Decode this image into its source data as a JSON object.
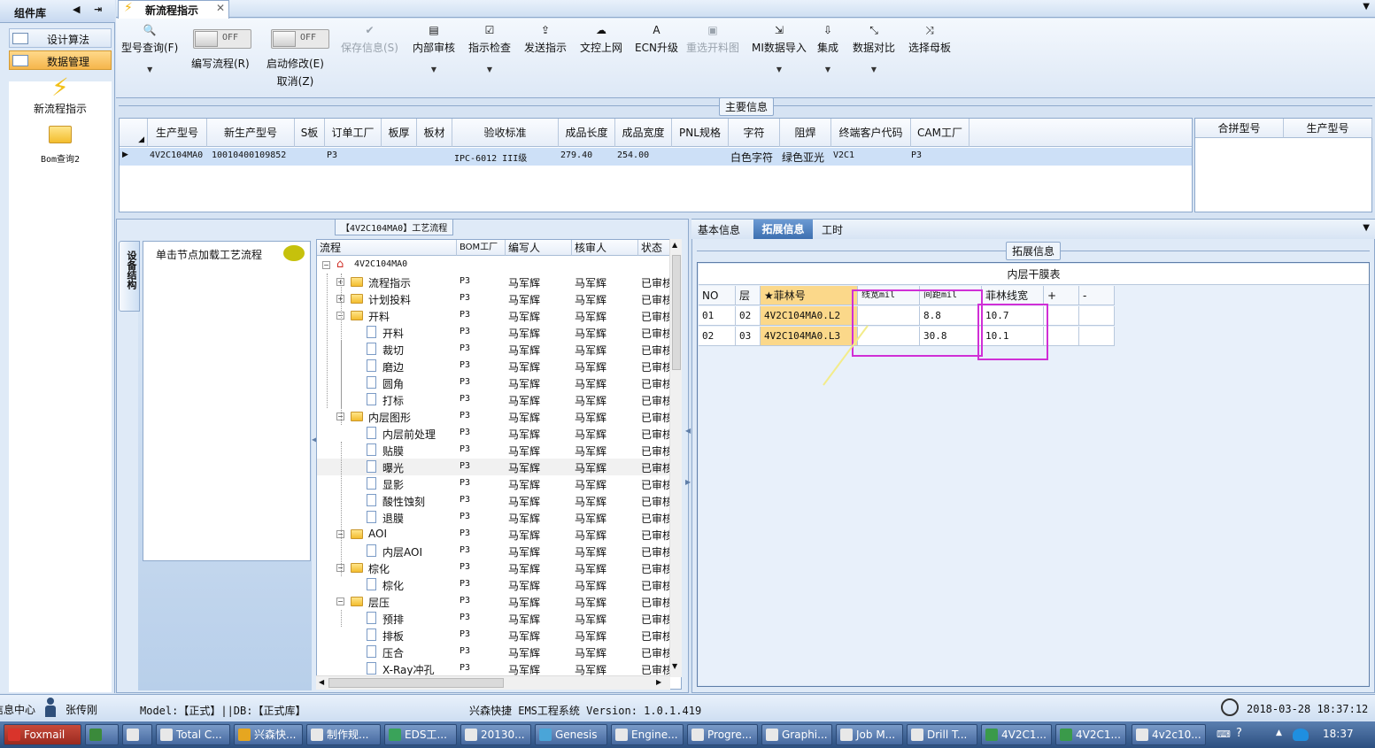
{
  "sidebar": {
    "title": "组件库",
    "items": [
      {
        "label": "设计算法"
      },
      {
        "label": "数据管理"
      },
      {
        "label": "新流程指示"
      },
      {
        "label": "Bom查询2"
      }
    ]
  },
  "doc_tab": {
    "title": "新流程指示"
  },
  "toolbar": {
    "model_query": "型号查询(F)",
    "write_flow": "编写流程(R)",
    "start_edit": "启动修改(E)",
    "cancel": "取消(Z)",
    "toggle_off": "OFF",
    "save_info": "保存信息(S)",
    "internal_review": "内部审核",
    "instr_check": "指示检查",
    "send_instr": "发送指示",
    "doc_control": "文控上网",
    "ecn_upgrade": "ECN升级",
    "reselect_diagram": "重选开料图",
    "mi_import": "MI数据导入",
    "integrate": "集成",
    "data_compare": "数据对比",
    "select_mother": "选择母板"
  },
  "main_info": {
    "label": "主要信息",
    "columns": [
      "生产型号",
      "新生产型号",
      "S板",
      "订单工厂",
      "板厚",
      "板材",
      "验收标准",
      "成品长度",
      "成品宽度",
      "PNL规格",
      "字符",
      "阻焊",
      "终端客户代码",
      "CAM工厂"
    ],
    "row": {
      "prod_model": "4V2C104MA0",
      "new_model": "10010400109852",
      "order_factory": "P3",
      "acceptance": "IPC-6012 III级",
      "length": "279.40",
      "width": "254.00",
      "chars": "白色字符",
      "solder": "绿色亚光",
      "customer": "V2C1",
      "cam_factory": "P3"
    },
    "merge_columns": [
      "合拼型号",
      "生产型号"
    ]
  },
  "flow": {
    "title": "【4V2C104MA0】工艺流程",
    "side_tab": "设备结构",
    "load_hint": "单击节点加载工艺流程",
    "columns": [
      "流程",
      "BOM工厂",
      "编写人",
      "核审人",
      "状态"
    ],
    "root": "4V2C104MA0",
    "bom": "P3",
    "writer": "马军辉",
    "reviewer": "马军辉",
    "status": "已审核",
    "nodes": [
      "流程指示",
      "计划投料",
      "开料",
      "开料",
      "裁切",
      "磨边",
      "圆角",
      "打标",
      "内层图形",
      "内层前处理",
      "贴膜",
      "曝光",
      "显影",
      "酸性蚀刻",
      "退膜",
      "AOI",
      "内层AOI",
      "棕化",
      "棕化",
      "层压",
      "预排",
      "排板",
      "压合",
      "X-Ray冲孔"
    ]
  },
  "right": {
    "tabs": [
      "基本信息",
      "拓展信息",
      "工时"
    ],
    "ext_label": "拓展信息",
    "table_title": "内层干膜表",
    "columns": [
      "NO",
      "层",
      "★菲林号",
      "线宽mil",
      "间距mil",
      "菲林线宽",
      "+",
      "-"
    ],
    "rows": [
      {
        "no": "01",
        "layer": "02",
        "film": "4V2C104MA0.L2",
        "width": "",
        "spacing": "8.8",
        "film_width": "10.7"
      },
      {
        "no": "02",
        "layer": "03",
        "film": "4V2C104MA0.L3",
        "width": "",
        "spacing": "30.8",
        "film_width": "10.1"
      }
    ]
  },
  "status_bar": {
    "msg_center": "信息中心",
    "user": "张传刚",
    "model_db": "Model:【正式】||DB:【正式库】",
    "app": "兴森快捷 EMS工程系统 Version: 1.0.1.419",
    "datetime": "2018-03-28 18:37:12"
  },
  "taskbar": {
    "items": [
      "Foxmail",
      "",
      "",
      "Total C...",
      "兴森快...",
      "制作规...",
      "EDS工...",
      "20130...",
      "Genesis",
      "Engine...",
      "Progre...",
      "Graphi...",
      "Job M...",
      "Drill T...",
      "4V2C1...",
      "4V2C1...",
      "4v2c10..."
    ],
    "clock": "18:37"
  },
  "colors": {
    "accent": "#3d6fb0",
    "highlight": "#fbd88a",
    "annotation": "#d02fd6",
    "selected_row": "#cde0f7"
  }
}
